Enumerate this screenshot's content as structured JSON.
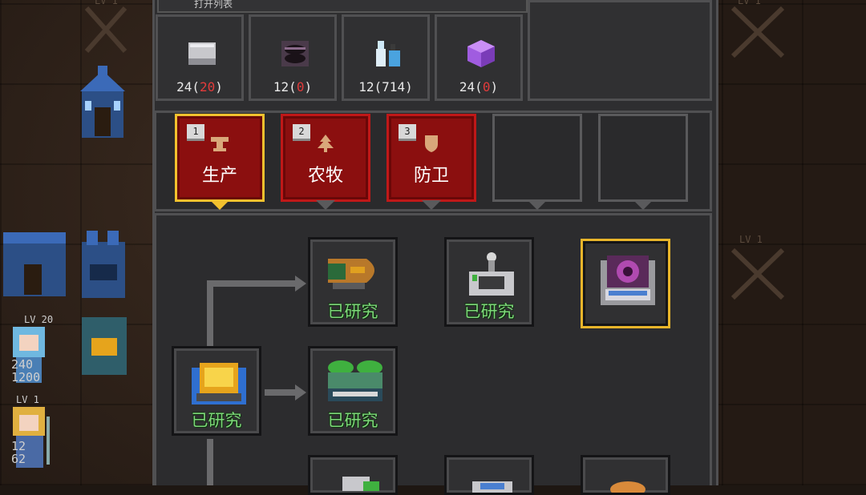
{
  "top_slot": {
    "text": "打开列表"
  },
  "resources": [
    {
      "name": "stone",
      "count": "24",
      "extra": "20",
      "icon": "stone-block-icon",
      "color": "#c8c8cc"
    },
    {
      "name": "ore",
      "count": "12",
      "extra": "0",
      "icon": "dark-ore-icon",
      "color": "#5a3e5a"
    },
    {
      "name": "potion",
      "count": "12",
      "extra": "714",
      "icon": "potion-bottles-icon",
      "color": "#4aa3df"
    },
    {
      "name": "crystal",
      "count": "24",
      "extra": "0",
      "icon": "purple-cube-icon",
      "color": "#a05ce0"
    }
  ],
  "tabs": [
    {
      "num": "1",
      "label": "生产",
      "selected": true
    },
    {
      "num": "2",
      "label": "农牧",
      "selected": false
    },
    {
      "num": "3",
      "label": "防卫",
      "selected": false
    }
  ],
  "tree": {
    "researched_label": "已研究",
    "nodes": [
      {
        "id": "furnace",
        "state": "researched"
      },
      {
        "id": "airship",
        "state": "researched"
      },
      {
        "id": "turret",
        "state": "researched"
      },
      {
        "id": "portal",
        "state": "selected"
      },
      {
        "id": "green-tanks",
        "state": "researched"
      }
    ]
  },
  "left_units": [
    {
      "level": "LV 20",
      "stats": [
        "240",
        "1200"
      ]
    },
    {
      "level": "LV 1",
      "stats": [
        "12",
        "62"
      ]
    }
  ],
  "map_levels": [
    "LV 1",
    "LV 1",
    "LV 1"
  ],
  "colors": {
    "tab_red": "#8b0f0f",
    "selected_gold": "#f2c12e",
    "researched_green": "#7ed87a",
    "count_red": "#e23b3b"
  }
}
